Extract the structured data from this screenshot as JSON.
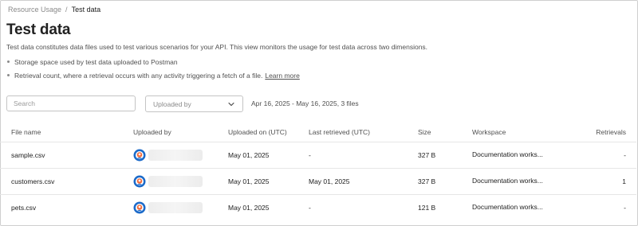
{
  "breadcrumb": {
    "parent": "Resource Usage",
    "separator": "/",
    "current": "Test data"
  },
  "page": {
    "title": "Test data",
    "description": "Test data constitutes data files used to test various scenarios for your API. This view monitors the usage for test data across two dimensions.",
    "bullets": [
      "Storage space used by test data uploaded to Postman",
      "Retrieval count, where a retrieval occurs with any activity triggering a fetch of a file."
    ],
    "learn_more": "Learn more"
  },
  "filters": {
    "search_placeholder": "Search",
    "uploaded_by_placeholder": "Uploaded by",
    "summary": "Apr 16, 2025 - May 16, 2025, 3 files"
  },
  "table": {
    "columns": [
      "File name",
      "Uploaded by",
      "Uploaded on (UTC)",
      "Last retrieved (UTC)",
      "Size",
      "Workspace",
      "Retrievals"
    ],
    "rows": [
      {
        "file": "sample.csv",
        "uploaded_on": "May 01, 2025",
        "last_retrieved": "-",
        "size": "327 B",
        "workspace": "Documentation works...",
        "retrievals": "-"
      },
      {
        "file": "customers.csv",
        "uploaded_on": "May 01, 2025",
        "last_retrieved": "May 01, 2025",
        "size": "327 B",
        "workspace": "Documentation works...",
        "retrievals": "1"
      },
      {
        "file": "pets.csv",
        "uploaded_on": "May 01, 2025",
        "last_retrieved": "-",
        "size": "121 B",
        "workspace": "Documentation works...",
        "retrievals": "-"
      }
    ]
  },
  "icons": {
    "dropdown": "chevron-down-icon",
    "avatar": "user-avatar-icon"
  },
  "colors": {
    "avatar_blue": "#1b6ac9",
    "avatar_orange": "#f26b3a"
  }
}
